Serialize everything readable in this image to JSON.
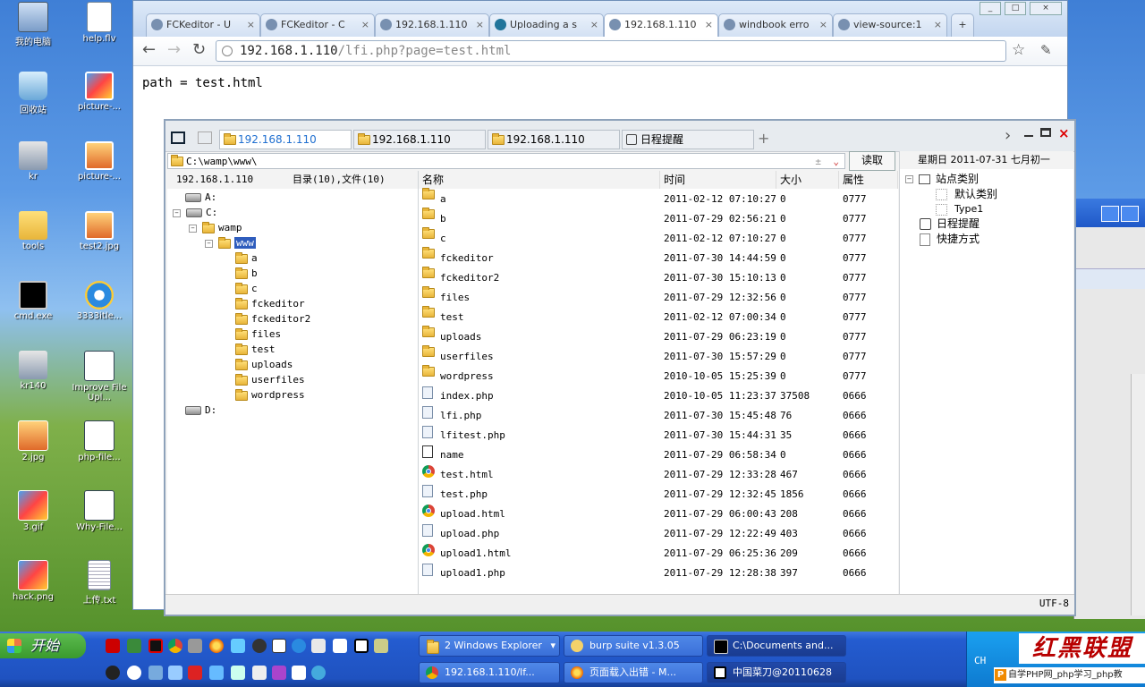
{
  "desktop": {
    "left_icons": [
      "我的电脑",
      "回收站",
      "kr",
      "tools",
      "cmd.exe",
      "kr140",
      "2.jpg",
      "3.gif",
      "hack.png"
    ],
    "right_icons": [
      "help.flv",
      "picture-...",
      "picture-...",
      "test2.jpg",
      "3333itle...",
      "Improve File Upl...",
      "php-file...",
      "Why-File...",
      "上传.txt"
    ]
  },
  "browser": {
    "tabs": [
      "FCKeditor - U",
      "FCKeditor - C",
      "192.168.1.110",
      "Uploading a s",
      "192.168.1.110",
      "windbook erro",
      "view-source:1"
    ],
    "new_tab": "+",
    "url_host": "192.168.1.110",
    "url_path": "/lfi.php?page=test.html",
    "page_text": "path = test.html"
  },
  "filemanager": {
    "tabs": [
      "192.168.1.110",
      "192.168.1.110",
      "192.168.1.110",
      "日程提醒"
    ],
    "add_tab": "+",
    "address": "C:\\wamp\\www\\",
    "read_button": "读取",
    "tree_header_host": "192.168.1.110",
    "tree_header_count": "目录(10),文件(10)",
    "tree": {
      "drive_a": "A:",
      "drive_c": "C:",
      "wamp": "wamp",
      "www": "www",
      "folders": [
        "a",
        "b",
        "c",
        "fckeditor",
        "fckeditor2",
        "files",
        "test",
        "uploads",
        "userfiles",
        "wordpress"
      ],
      "drive_d": "D:"
    },
    "columns": [
      "名称",
      "时间",
      "大小",
      "属性"
    ],
    "rows": [
      {
        "name": "a",
        "time": "2011-02-12 07:10:27",
        "size": "0",
        "attr": "0777",
        "icon": "folder"
      },
      {
        "name": "b",
        "time": "2011-07-29 02:56:21",
        "size": "0",
        "attr": "0777",
        "icon": "folder"
      },
      {
        "name": "c",
        "time": "2011-02-12 07:10:27",
        "size": "0",
        "attr": "0777",
        "icon": "folder"
      },
      {
        "name": "fckeditor",
        "time": "2011-07-30 14:44:59",
        "size": "0",
        "attr": "0777",
        "icon": "folder"
      },
      {
        "name": "fckeditor2",
        "time": "2011-07-30 15:10:13",
        "size": "0",
        "attr": "0777",
        "icon": "folder"
      },
      {
        "name": "files",
        "time": "2011-07-29 12:32:56",
        "size": "0",
        "attr": "0777",
        "icon": "folder"
      },
      {
        "name": "test",
        "time": "2011-02-12 07:00:34",
        "size": "0",
        "attr": "0777",
        "icon": "folder"
      },
      {
        "name": "uploads",
        "time": "2011-07-29 06:23:19",
        "size": "0",
        "attr": "0777",
        "icon": "folder"
      },
      {
        "name": "userfiles",
        "time": "2011-07-30 15:57:29",
        "size": "0",
        "attr": "0777",
        "icon": "folder"
      },
      {
        "name": "wordpress",
        "time": "2010-10-05 15:25:39",
        "size": "0",
        "attr": "0777",
        "icon": "folder"
      },
      {
        "name": "index.php",
        "time": "2010-10-05 11:23:37",
        "size": "37508",
        "attr": "0666",
        "icon": "file"
      },
      {
        "name": "lfi.php",
        "time": "2011-07-30 15:45:48",
        "size": "76",
        "attr": "0666",
        "icon": "file"
      },
      {
        "name": "lfitest.php",
        "time": "2011-07-30 15:44:31",
        "size": "35",
        "attr": "0666",
        "icon": "file"
      },
      {
        "name": "name",
        "time": "2011-07-29 06:58:34",
        "size": "0",
        "attr": "0666",
        "icon": "sys"
      },
      {
        "name": "test.html",
        "time": "2011-07-29 12:33:28",
        "size": "467",
        "attr": "0666",
        "icon": "chrome"
      },
      {
        "name": "test.php",
        "time": "2011-07-29 12:32:45",
        "size": "1856",
        "attr": "0666",
        "icon": "file"
      },
      {
        "name": "upload.html",
        "time": "2011-07-29 06:00:43",
        "size": "208",
        "attr": "0666",
        "icon": "chrome"
      },
      {
        "name": "upload.php",
        "time": "2011-07-29 12:22:49",
        "size": "403",
        "attr": "0666",
        "icon": "file"
      },
      {
        "name": "upload1.html",
        "time": "2011-07-29 06:25:36",
        "size": "209",
        "attr": "0666",
        "icon": "chrome"
      },
      {
        "name": "upload1.php",
        "time": "2011-07-29 12:28:38",
        "size": "397",
        "attr": "0666",
        "icon": "file"
      }
    ],
    "side": {
      "date": "星期日  2011-07-31  七月初一",
      "site_category": "站点类别",
      "default_category": "默认类别",
      "type1": "Type1",
      "schedule": "日程提醒",
      "shortcut": "快捷方式"
    },
    "encoding": "UTF-8"
  },
  "taskbar": {
    "start": "开始",
    "buttons_top": [
      "2 Windows Explorer",
      "burp suite v1.3.05",
      "C:\\Documents and..."
    ],
    "buttons_bottom": [
      "192.168.1.110/lf...",
      "页面载入出错 - M...",
      "中国菜刀@20110628"
    ],
    "lang": "CH",
    "watermark": "红黑联盟",
    "watermark_sub": "自学PHP网_php学习_php教"
  }
}
